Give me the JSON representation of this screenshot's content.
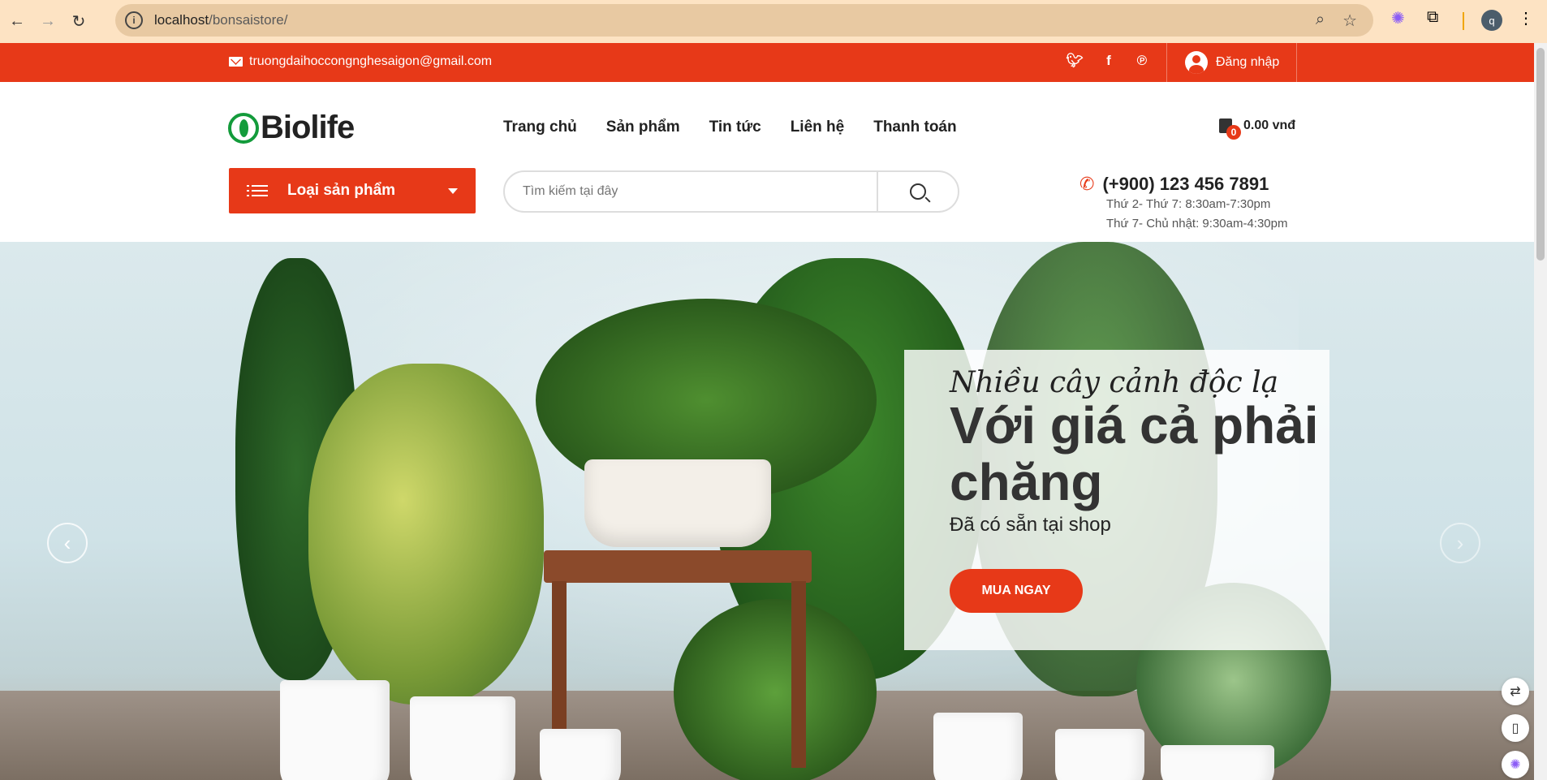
{
  "browser": {
    "url_host": "localhost",
    "url_path": "/bonsaistore/",
    "profile_initial": "q"
  },
  "topbar": {
    "email": "truongdaihoccongnghesaigon@gmail.com",
    "login_label": "Đăng nhập"
  },
  "header": {
    "logo_text": "Biolife",
    "nav": [
      "Trang chủ",
      "Sản phẩm",
      "Tin tức",
      "Liên hệ",
      "Thanh toán"
    ],
    "cart_count": "0",
    "cart_total": "0.00 vnđ"
  },
  "category": {
    "label": "Loại sản phẩm"
  },
  "search": {
    "placeholder": "Tìm kiếm tại đây"
  },
  "contact": {
    "phone": "(+900) 123 456 7891",
    "hours_1": "Thứ 2- Thứ 7: 8:30am-7:30pm",
    "hours_2": "Thứ 7- Chủ nhật: 9:30am-4:30pm"
  },
  "hero": {
    "subtitle": "Nhiều cây cảnh độc lạ",
    "title": "Với giá cả phải chăng",
    "description": "Đã có sẵn tại shop",
    "button": "MUA NGAY"
  },
  "colors": {
    "accent": "#e73918",
    "brand_green": "#139b3b"
  }
}
